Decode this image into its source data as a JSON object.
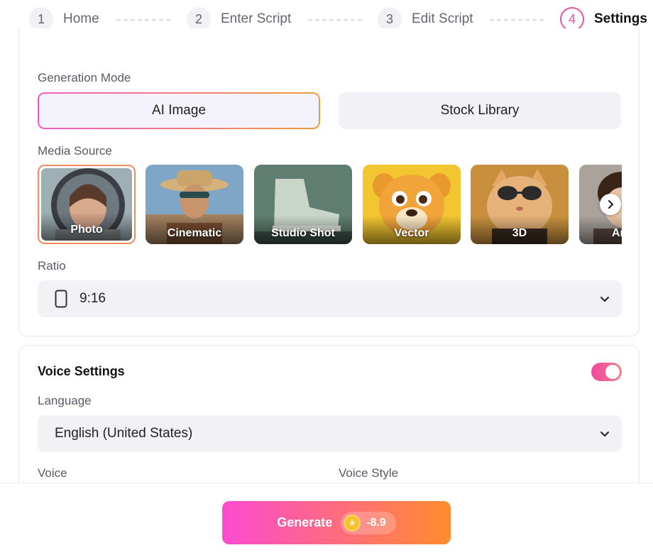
{
  "stepper": {
    "steps": [
      {
        "num": "1",
        "label": "Home"
      },
      {
        "num": "2",
        "label": "Enter Script"
      },
      {
        "num": "3",
        "label": "Edit Script"
      },
      {
        "num": "4",
        "label": "Settings"
      }
    ],
    "active_step": 4
  },
  "generation": {
    "label": "Generation Mode",
    "modes": [
      "AI Image",
      "Stock Library"
    ],
    "selected": "AI Image"
  },
  "media": {
    "label": "Media Source",
    "items": [
      "Photo",
      "Cinematic",
      "Studio Shot",
      "Vector",
      "3D",
      "An"
    ],
    "selected": "Photo"
  },
  "ratio": {
    "label": "Ratio",
    "value": "9:16"
  },
  "voice": {
    "title": "Voice Settings",
    "enabled": true,
    "language_label": "Language",
    "language_value": "English (United States)",
    "voice_label": "Voice",
    "style_label": "Voice Style"
  },
  "footer": {
    "generate_label": "Generate",
    "cost": "-8.9"
  },
  "colors": {
    "accent_pink": "#f0479f",
    "accent_orange": "#ff8c2e"
  }
}
